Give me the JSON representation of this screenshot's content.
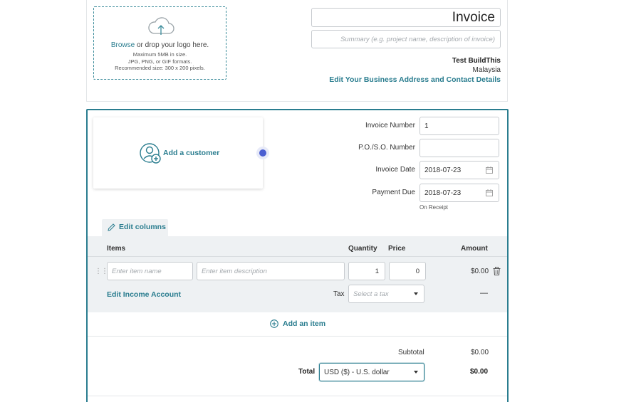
{
  "logo": {
    "browse_link": "Browse",
    "drop_text": " or drop your logo here.",
    "max_size": "Maximum 5MB in size.",
    "formats": "JPG, PNG, or GIF formats.",
    "recommended": "Recommended size: 300 x 200 pixels."
  },
  "header": {
    "title_value": "Invoice",
    "summary_placeholder": "Summary (e.g. project name, description of invoice)",
    "business_name": "Test BuildThis",
    "business_country": "Malaysia",
    "edit_business_link": "Edit Your Business Address and Contact Details"
  },
  "customer": {
    "add_label": "Add a customer"
  },
  "meta": {
    "invoice_number_label": "Invoice Number",
    "invoice_number_value": "1",
    "po_so_label": "P.O./S.O. Number",
    "po_so_value": "",
    "invoice_date_label": "Invoice Date",
    "invoice_date_value": "2018-07-23",
    "payment_due_label": "Payment Due",
    "payment_due_value": "2018-07-23",
    "payment_terms": "On Receipt"
  },
  "items_table": {
    "edit_columns_label": "Edit columns",
    "headers": {
      "items": "Items",
      "quantity": "Quantity",
      "price": "Price",
      "amount": "Amount"
    },
    "row": {
      "name_placeholder": "Enter item name",
      "description_placeholder": "Enter item description",
      "quantity": "1",
      "price": "0",
      "amount": "$0.00",
      "income_account_link": "Edit Income Account",
      "tax_label": "Tax",
      "tax_placeholder": "Select a tax",
      "tax_amount": "—"
    },
    "add_item_label": "Add an item"
  },
  "totals": {
    "subtotal_label": "Subtotal",
    "subtotal_value": "$0.00",
    "total_label": "Total",
    "currency_selected": "USD ($) - U.S. dollar",
    "total_value": "$0.00"
  },
  "colors": {
    "accent": "#2a7d8f",
    "focus_dot": "#4a5ed1",
    "table_bg": "#eef1f3"
  }
}
